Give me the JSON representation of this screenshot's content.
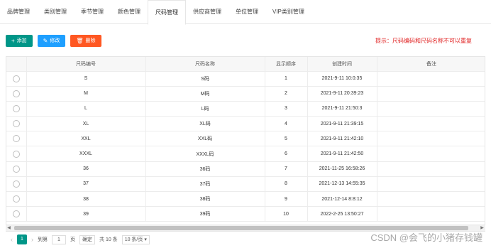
{
  "tabs": [
    {
      "label": "品牌管理"
    },
    {
      "label": "类别管理"
    },
    {
      "label": "季节管理"
    },
    {
      "label": "颜色管理"
    },
    {
      "label": "尺码管理",
      "active": true
    },
    {
      "label": "供应商管理"
    },
    {
      "label": "单位管理"
    },
    {
      "label": "VIP类别管理"
    }
  ],
  "toolbar": {
    "add_label": "添加",
    "edit_label": "修改",
    "delete_label": "删除"
  },
  "tip": "提示：尺码编码和尺码名称不可以重复",
  "table": {
    "columns": [
      "",
      "尺码编号",
      "尺码名称",
      "显示顺序",
      "创建时间",
      "备注"
    ],
    "rows": [
      {
        "code": "S",
        "name": "S码",
        "order": "1",
        "created": "2021-9-11 10:0:35",
        "note": ""
      },
      {
        "code": "M",
        "name": "M码",
        "order": "2",
        "created": "2021-9-11 20:39:23",
        "note": ""
      },
      {
        "code": "L",
        "name": "L码",
        "order": "3",
        "created": "2021-9-11 21:50:3",
        "note": ""
      },
      {
        "code": "XL",
        "name": "XL码",
        "order": "4",
        "created": "2021-9-11 21:39:15",
        "note": ""
      },
      {
        "code": "XXL",
        "name": "XXL码",
        "order": "5",
        "created": "2021-9-11 21:42:10",
        "note": ""
      },
      {
        "code": "XXXL",
        "name": "XXXL码",
        "order": "6",
        "created": "2021-9-11 21:42:50",
        "note": ""
      },
      {
        "code": "36",
        "name": "36码",
        "order": "7",
        "created": "2021-11-25 16:58:26",
        "note": ""
      },
      {
        "code": "37",
        "name": "37码",
        "order": "8",
        "created": "2021-12-13 14:55:35",
        "note": ""
      },
      {
        "code": "38",
        "name": "38码",
        "order": "9",
        "created": "2021-12-14 8:8:12",
        "note": ""
      },
      {
        "code": "39",
        "name": "39码",
        "order": "10",
        "created": "2022-2-25 13:50:27",
        "note": ""
      }
    ]
  },
  "pager": {
    "current_page": "1",
    "goto_label": "到第",
    "goto_value": "1",
    "page_unit": "页",
    "confirm_label": "确定",
    "total_label": "共 10 条",
    "page_size_label": "10 条/页"
  },
  "watermark": "CSDN @会飞的小猪存钱罐"
}
